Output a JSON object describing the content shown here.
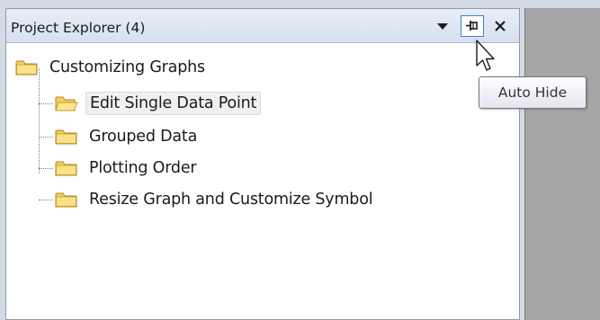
{
  "panel": {
    "title": "Project Explorer (4)",
    "buttons": {
      "dropdown_icon": "dropdown-triangle-icon",
      "pin_icon": "auto-hide-pin-icon",
      "close_icon": "close-x-icon"
    }
  },
  "tree": {
    "root": {
      "label": "Customizing Graphs",
      "icon": "folder-closed-icon"
    },
    "children": [
      {
        "label": "Edit Single Data Point",
        "icon": "folder-open-icon",
        "selected": true
      },
      {
        "label": "Grouped Data",
        "icon": "folder-closed-icon",
        "selected": false
      },
      {
        "label": "Plotting Order",
        "icon": "folder-closed-icon",
        "selected": false
      },
      {
        "label": "Resize Graph and Customize Symbol",
        "icon": "folder-closed-icon",
        "selected": false
      }
    ]
  },
  "tooltip": {
    "text": "Auto Hide"
  },
  "colors": {
    "titlebar": "#d7e0ef",
    "pin_border": "#3f7fd8",
    "folder_fill": "#f5cf5c",
    "right_area": "#a6a6a6"
  }
}
